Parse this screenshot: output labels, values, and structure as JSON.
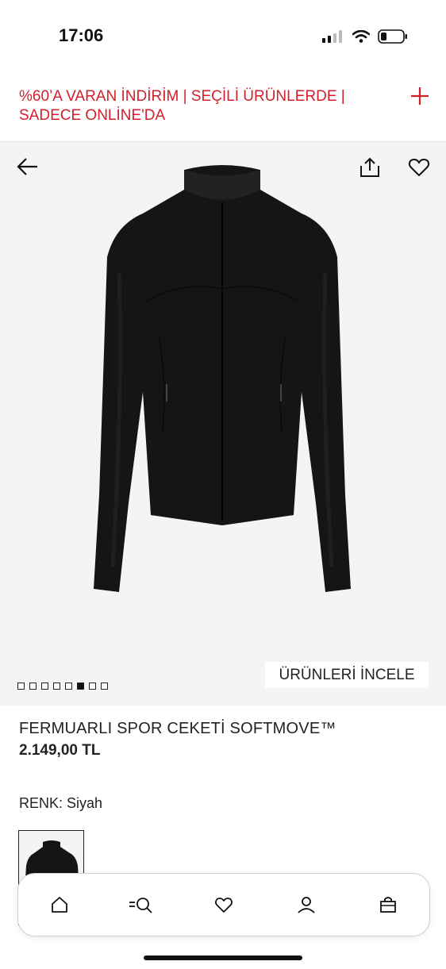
{
  "status_bar": {
    "time": "17:06"
  },
  "promo": {
    "text": "%60’A VARAN İNDİRİM | SEÇİLİ ÜRÜNLERDE | SADECE ONLİNE'DA",
    "accent_color": "#d41f2a"
  },
  "hero": {
    "back_icon": "arrow-left-icon",
    "share_icon": "share-icon",
    "favorite_icon": "heart-icon",
    "view_products_label": "ÜRÜNLERİ İNCELE",
    "image_count": 8,
    "active_image_index": 5
  },
  "product": {
    "name": "FERMUARLI SPOR CEKETİ SOFTMOVE™",
    "price": "2.149,00 TL",
    "color_label": "RENK:",
    "color_value": "Siyah"
  },
  "tabbar": {
    "items": [
      "home-icon",
      "search-icon",
      "heart-icon",
      "user-icon",
      "shopping-bag-icon"
    ]
  }
}
